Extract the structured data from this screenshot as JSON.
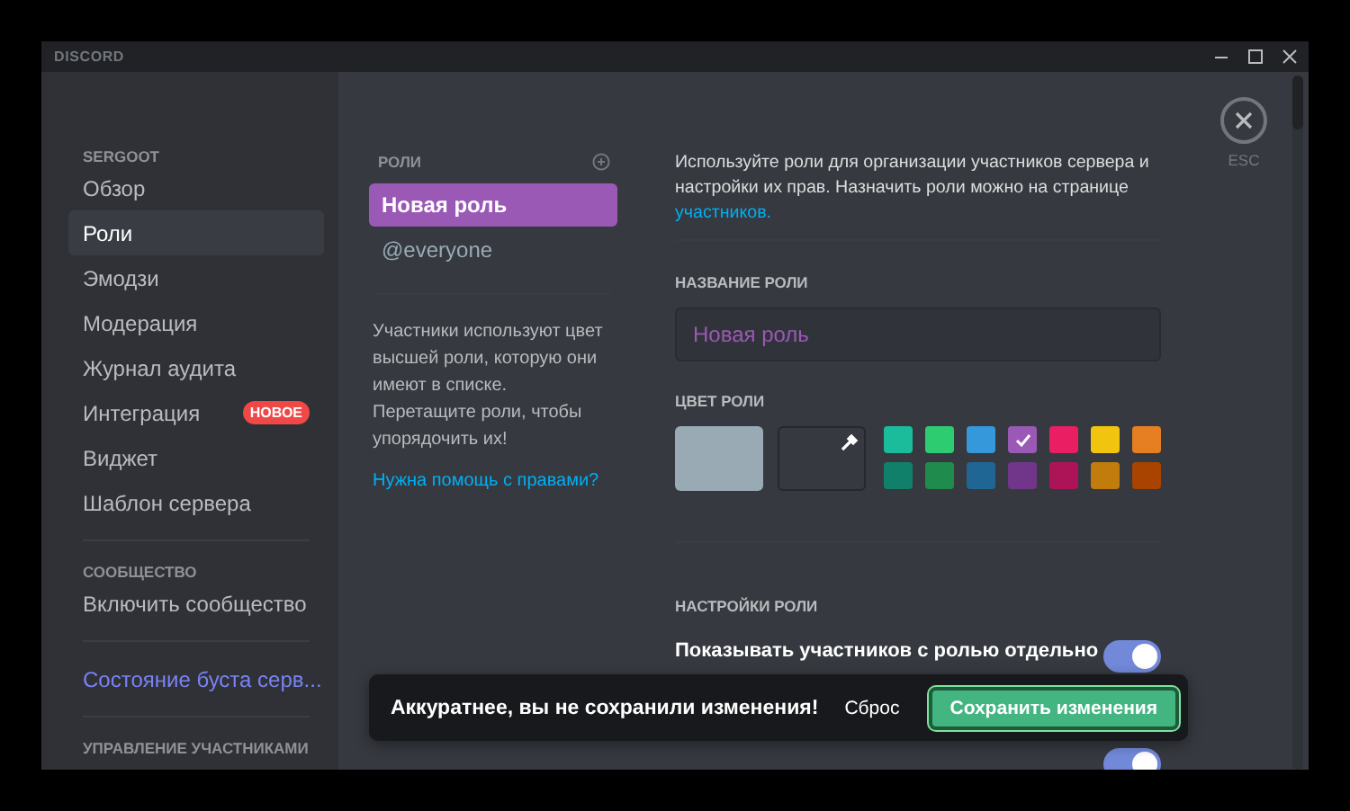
{
  "window": {
    "title": "DISCORD"
  },
  "sidebar": {
    "sections": [
      {
        "header": "SERGOOT",
        "items": [
          {
            "label": "Обзор",
            "selected": false
          },
          {
            "label": "Роли",
            "selected": true
          },
          {
            "label": "Эмодзи",
            "selected": false
          },
          {
            "label": "Модерация",
            "selected": false
          },
          {
            "label": "Журнал аудита",
            "selected": false
          },
          {
            "label": "Интеграция",
            "selected": false,
            "badge": "НОВОЕ"
          },
          {
            "label": "Виджет",
            "selected": false
          },
          {
            "label": "Шаблон сервера",
            "selected": false
          }
        ]
      },
      {
        "header": "СООБЩЕСТВО",
        "items": [
          {
            "label": "Включить сообщество",
            "selected": false
          }
        ]
      },
      {
        "items": [
          {
            "label": "Состояние буста серв...",
            "selected": false,
            "kind": "boost"
          }
        ]
      },
      {
        "header": "УПРАВЛЕНИЕ УЧАСТНИКАМИ"
      }
    ]
  },
  "roles": {
    "header": "РОЛИ",
    "items": [
      {
        "label": "Новая роль",
        "selected": true,
        "color": "#9b59b6"
      },
      {
        "label": "@everyone",
        "selected": false,
        "color": "#99aab5"
      }
    ],
    "hint": "Участники используют цвет высшей роли, которую они имеют в списке. Перетащите роли, чтобы упорядочить их!",
    "help_link": "Нужна помощь с правами?"
  },
  "content": {
    "intro": "Используйте роли для организации участников сервера и настройки их прав. Назначить роли можно на странице",
    "intro_link": "участников.",
    "close_label": "ESC",
    "name_label": "НАЗВАНИЕ РОЛИ",
    "name_value": "Новая роль",
    "color_label": "ЦВЕТ РОЛИ",
    "swatches": [
      {
        "color": "#1abc9c",
        "selected": false
      },
      {
        "color": "#2ecc71",
        "selected": false
      },
      {
        "color": "#3498db",
        "selected": false
      },
      {
        "color": "#9b59b6",
        "selected": true
      },
      {
        "color": "#e91e63",
        "selected": false
      },
      {
        "color": "#f1c40f",
        "selected": false
      },
      {
        "color": "#e67e22",
        "selected": false
      },
      {
        "color": "#11806a",
        "selected": false
      },
      {
        "color": "#1f8b4c",
        "selected": false
      },
      {
        "color": "#206694",
        "selected": false
      },
      {
        "color": "#71368a",
        "selected": false
      },
      {
        "color": "#ad1457",
        "selected": false
      },
      {
        "color": "#c27c0e",
        "selected": false
      },
      {
        "color": "#a84300",
        "selected": false
      }
    ],
    "settings_label": "НАСТРОЙКИ РОЛИ",
    "settings": [
      {
        "label": "Показывать участников с ролью отдельно",
        "on": true
      },
      {
        "on": true
      }
    ]
  },
  "notice": {
    "text": "Аккуратнее, вы не сохранили изменения!",
    "reset": "Сброс",
    "save": "Сохранить изменения"
  }
}
